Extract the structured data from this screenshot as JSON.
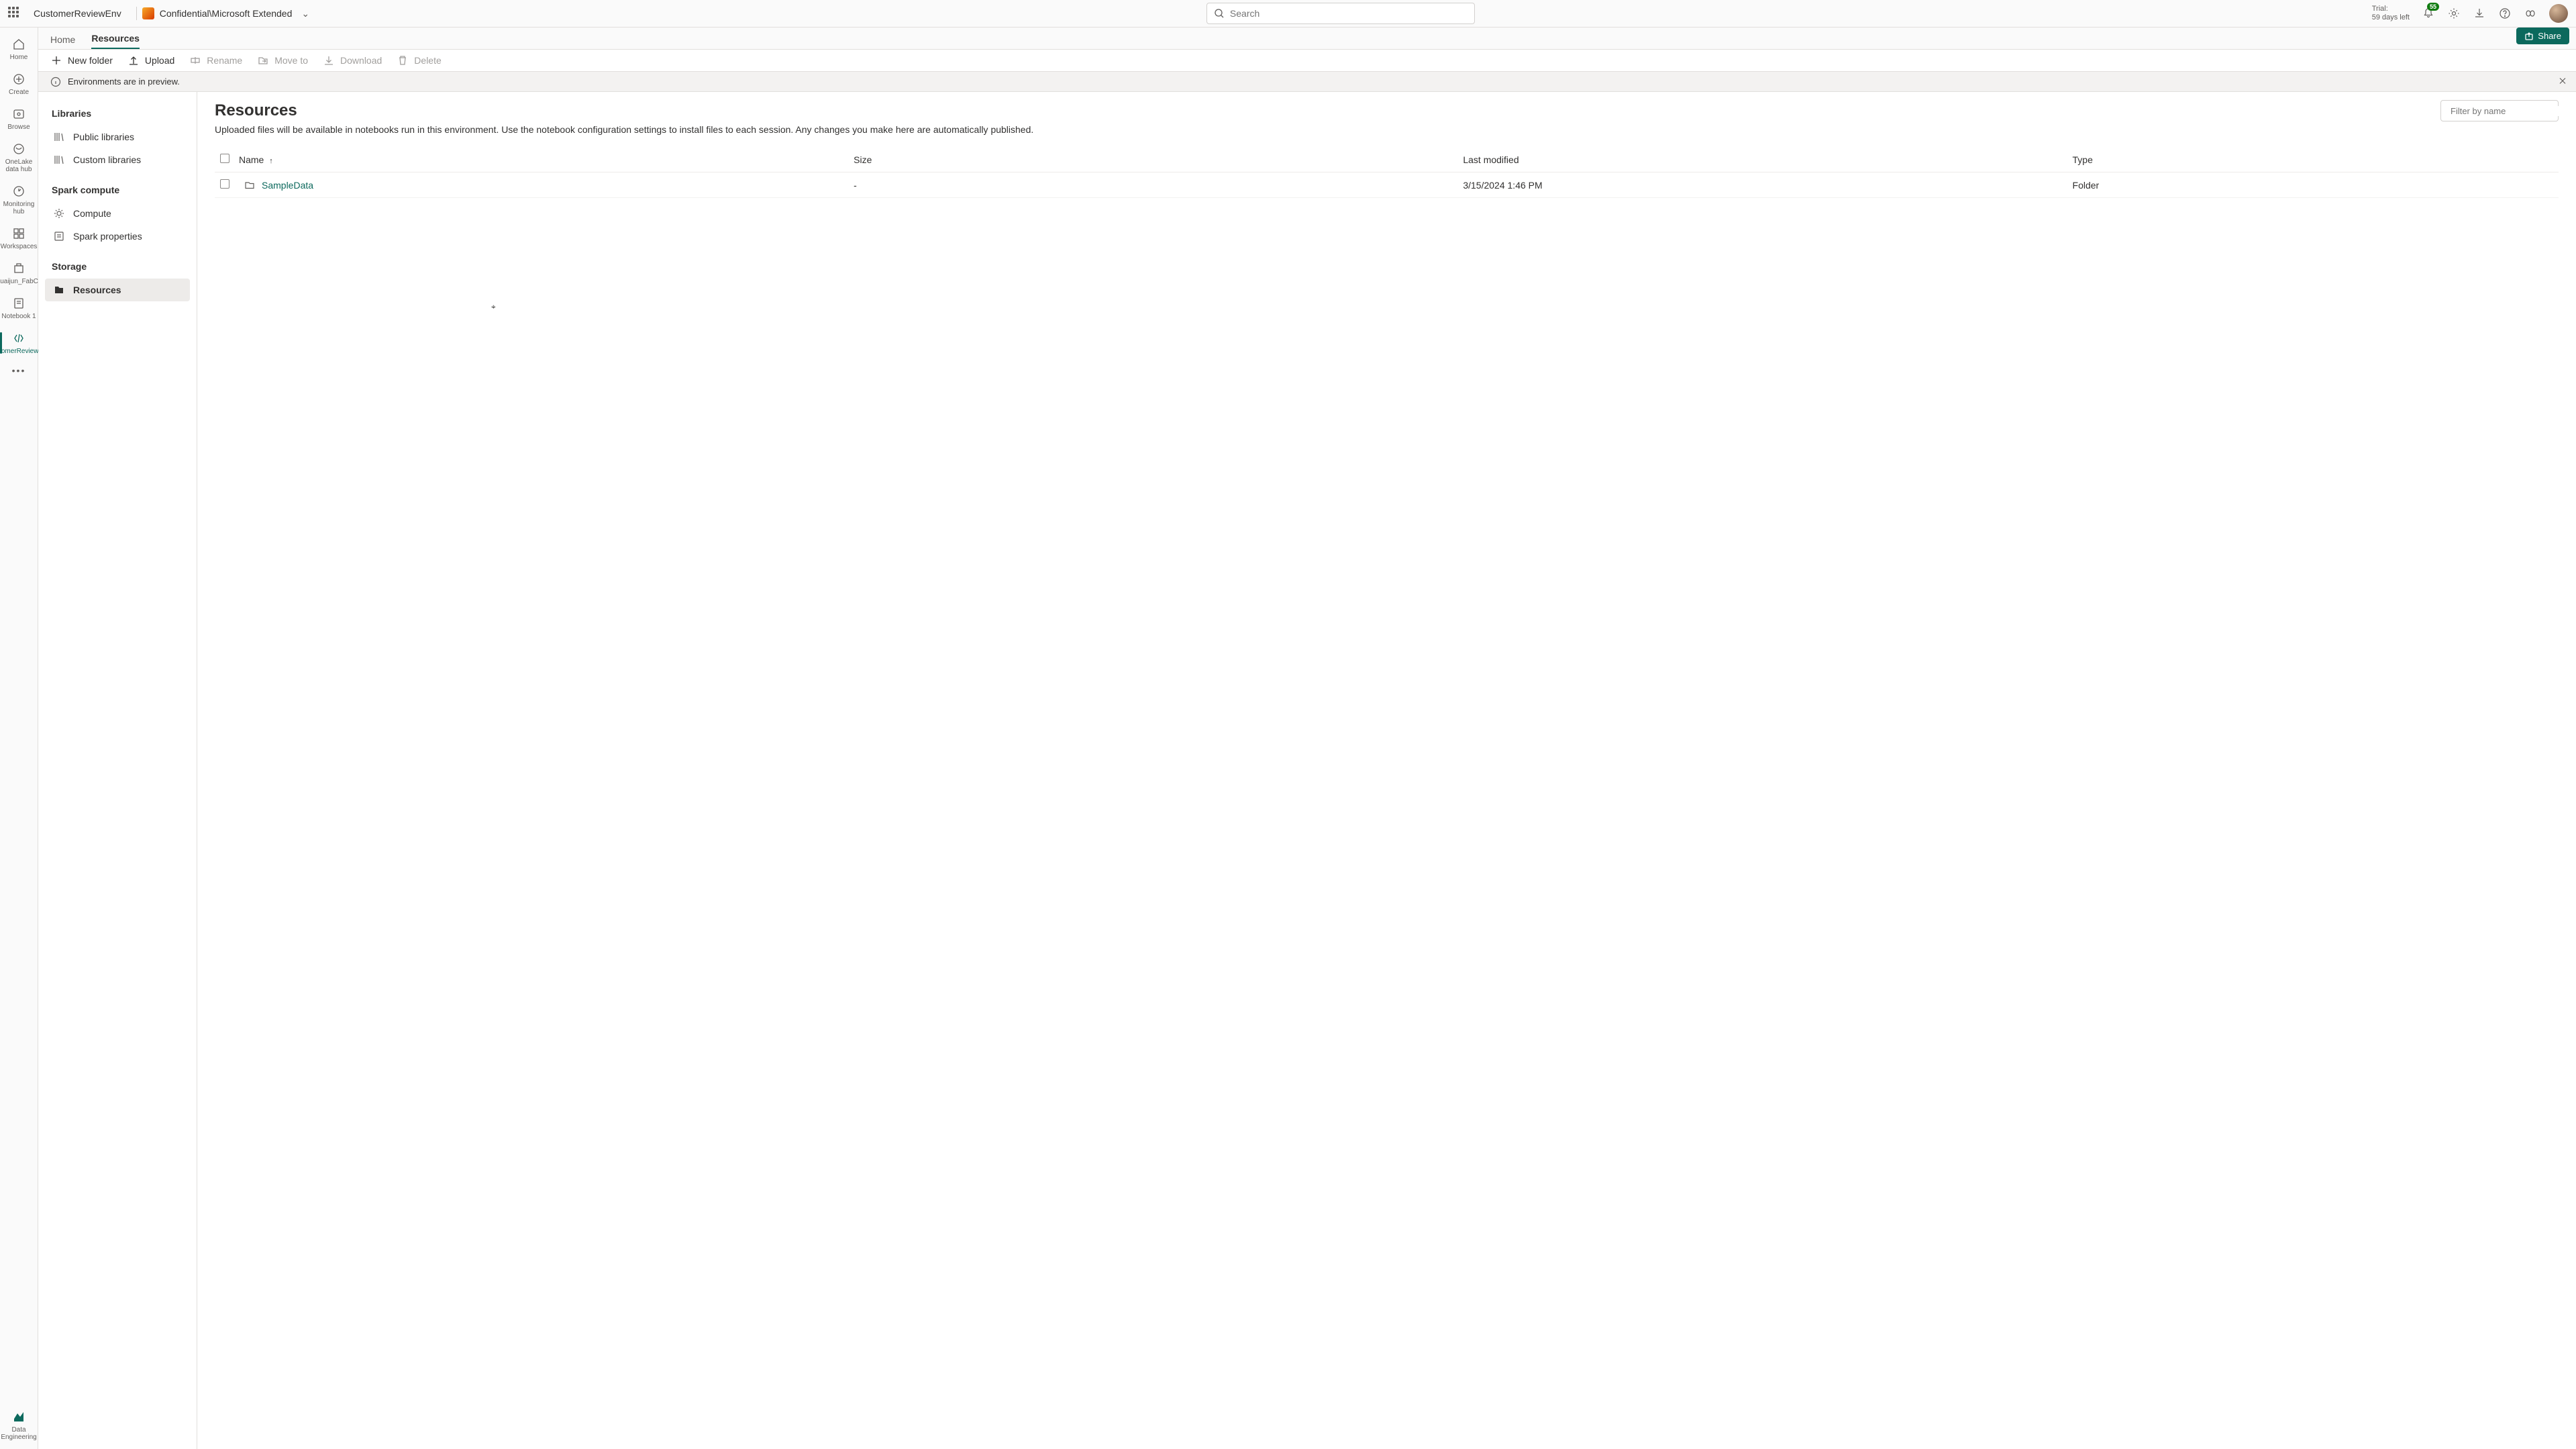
{
  "header": {
    "env_name": "CustomerReviewEnv",
    "classification": "Confidential\\Microsoft Extended",
    "search_placeholder": "Search",
    "trial_label": "Trial:",
    "trial_days": "59 days left",
    "notification_count": "55"
  },
  "rail": {
    "items": [
      {
        "label": "Home"
      },
      {
        "label": "Create"
      },
      {
        "label": "Browse"
      },
      {
        "label": "OneLake data hub"
      },
      {
        "label": "Monitoring hub"
      },
      {
        "label": "Workspaces"
      },
      {
        "label": "Shuaijun_FabCon"
      },
      {
        "label": "Notebook 1"
      },
      {
        "label": "CustomerReviewEnv"
      }
    ],
    "more": "•••",
    "persona": "Data Engineering"
  },
  "tabs": {
    "home": "Home",
    "resources": "Resources",
    "share": "Share"
  },
  "toolbar": {
    "new_folder": "New folder",
    "upload": "Upload",
    "rename": "Rename",
    "move_to": "Move to",
    "download": "Download",
    "delete": "Delete"
  },
  "banner": {
    "text": "Environments are in preview."
  },
  "sidebar": {
    "groups": [
      {
        "title": "Libraries",
        "items": [
          {
            "label": "Public libraries"
          },
          {
            "label": "Custom libraries"
          }
        ]
      },
      {
        "title": "Spark compute",
        "items": [
          {
            "label": "Compute"
          },
          {
            "label": "Spark properties"
          }
        ]
      },
      {
        "title": "Storage",
        "items": [
          {
            "label": "Resources",
            "active": true
          }
        ]
      }
    ]
  },
  "main": {
    "title": "Resources",
    "description": "Uploaded files will be available in notebooks run in this environment. Use the notebook configuration settings to install files to each session. Any changes you make here are automatically published.",
    "filter_placeholder": "Filter by name",
    "columns": {
      "name": "Name",
      "size": "Size",
      "modified": "Last modified",
      "type": "Type"
    },
    "rows": [
      {
        "name": "SampleData",
        "size": "-",
        "modified": "3/15/2024 1:46 PM",
        "type": "Folder"
      }
    ]
  }
}
